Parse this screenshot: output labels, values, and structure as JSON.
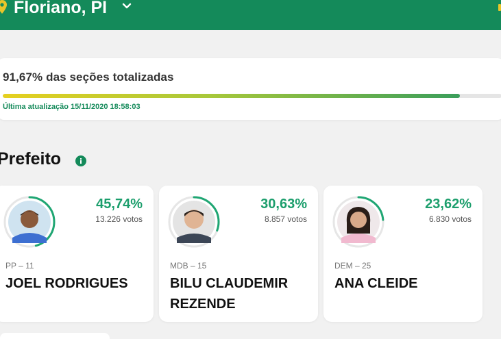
{
  "header": {
    "city": "Floriano, PI",
    "pin_icon": "location-pin-icon",
    "chevron_icon": "chevron-down-icon",
    "bg_color": "#148a5a"
  },
  "progress": {
    "label": "91,67% das seções totalizadas",
    "value_percent": 91.67,
    "updated": "Última atualização 15/11/2020 18:58:03"
  },
  "section": {
    "title": "Prefeito",
    "info_icon": "info-icon"
  },
  "candidates": [
    {
      "percent": "45,74%",
      "percent_value": 45.74,
      "votes": "13.226 votos",
      "party": "PP – 11",
      "name": "JOEL RODRIGUES",
      "avatar_icon": "candidate-photo"
    },
    {
      "percent": "30,63%",
      "percent_value": 30.63,
      "votes": "8.857 votos",
      "party": "MDB – 15",
      "name": "BILU CLAUDEMIR REZENDE",
      "avatar_icon": "candidate-photo"
    },
    {
      "percent": "23,62%",
      "percent_value": 23.62,
      "votes": "6.830 votos",
      "party": "DEM – 25",
      "name": "ANA CLEIDE",
      "avatar_icon": "candidate-photo"
    }
  ],
  "colors": {
    "accent": "#1b9e6c",
    "ring": "#1fa673"
  }
}
